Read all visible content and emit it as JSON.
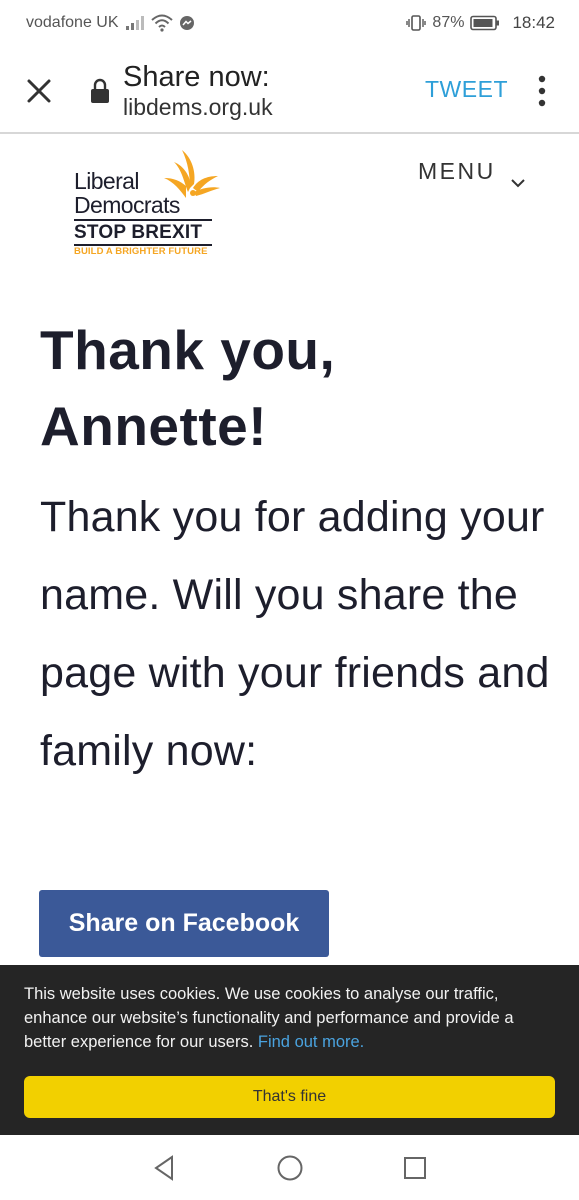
{
  "status_bar": {
    "carrier": "vodafone UK",
    "battery": "87%",
    "time": "18:42"
  },
  "toolbar": {
    "title": "Share now:",
    "url": "libdems.org.uk",
    "tweet_label": "TWEET"
  },
  "logo": {
    "line1": "Liberal",
    "line2": "Democrats",
    "line3": "STOP BREXIT",
    "line4": "BUILD A BRIGHTER FUTURE"
  },
  "menu": {
    "label": "MENU"
  },
  "main": {
    "heading_line1": "Thank you,",
    "heading_line2": "Annette!",
    "body": "Thank you for adding your name. Will you share the page with your friends and family now:",
    "share_facebook_label": "Share on Facebook"
  },
  "cookie_banner": {
    "message": "This website uses cookies. We use cookies to analyse our traffic, enhance our website’s functionality and performance and provide a better experience for our users.",
    "link_text": "Find out more.",
    "accept_label": "That's fine"
  },
  "colors": {
    "tweet": "#2e9fd8",
    "facebook": "#3b5998",
    "cookie_bg": "#252525",
    "cookie_button": "#f2d000",
    "brand_gold": "#f5a623"
  },
  "icons": {
    "close": "close-icon",
    "lock": "lock-icon",
    "more": "more-vertical-icon",
    "menu_chevron": "chevron-down-icon",
    "back": "back-triangle-icon",
    "home": "home-circle-icon",
    "recents": "recents-square-icon"
  }
}
